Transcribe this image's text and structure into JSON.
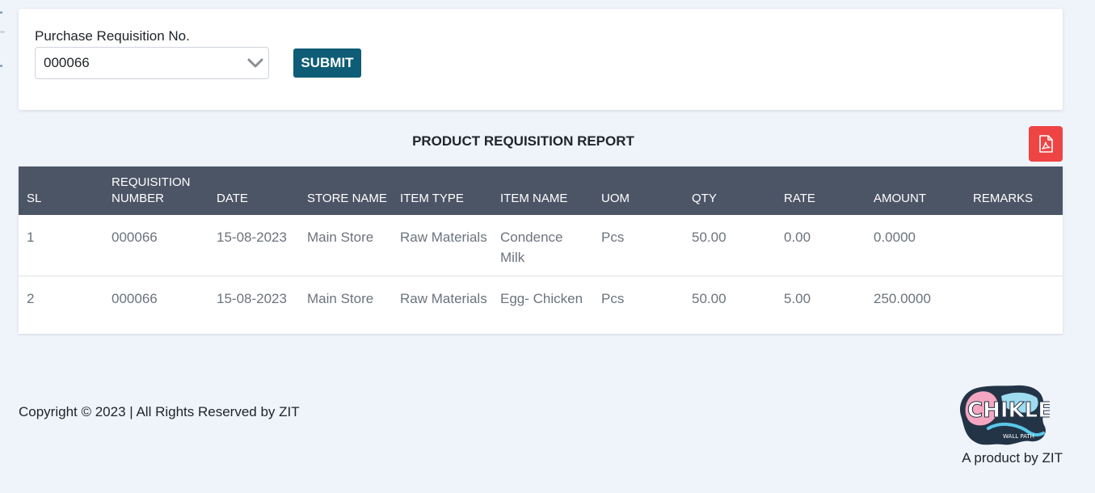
{
  "form": {
    "label": "Purchase Requisition No.",
    "selected_value": "000066",
    "submit_label": "SUBMIT"
  },
  "report": {
    "title": "PRODUCT REQUISITION REPORT",
    "pdf_icon": "pdf-file-icon",
    "columns": [
      "SL",
      "REQUISITION NUMBER",
      "DATE",
      "STORE NAME",
      "ITEM TYPE",
      "ITEM NAME",
      "UOM",
      "QTY",
      "RATE",
      "AMOUNT",
      "REMARKS"
    ],
    "rows": [
      [
        "1",
        "000066",
        "15-08-2023",
        "Main Store",
        "Raw Materials",
        "Condence Milk",
        "Pcs",
        "50.00",
        "0.00",
        "0.0000",
        ""
      ],
      [
        "2",
        "000066",
        "15-08-2023",
        "Main Store",
        "Raw Materials",
        "Egg- Chicken",
        "Pcs",
        "50.00",
        "5.00",
        "250.0000",
        ""
      ]
    ]
  },
  "footer": {
    "copyright": "Copyright © 2023 | All Rights Reserved by ZIT",
    "logo_text": "CHIKLEE",
    "logo_subtext": "WALL PATH",
    "product_by": "A product by ZIT"
  },
  "colors": {
    "page_bg": "#eff4fb",
    "submit_bg": "#0e5c76",
    "table_header_bg": "#4c5566",
    "pdf_button_bg": "#ef4444"
  }
}
